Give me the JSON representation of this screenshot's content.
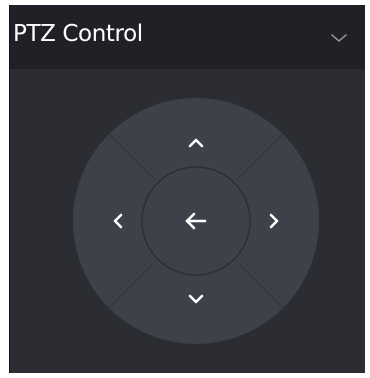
{
  "panel": {
    "title": "PTZ Control",
    "collapse_icon": "chevron-down-icon"
  },
  "ptz": {
    "buttons": [
      {
        "direction": "up",
        "icon": "chevron-up-icon"
      },
      {
        "direction": "left",
        "icon": "chevron-left-icon"
      },
      {
        "direction": "right",
        "icon": "chevron-right-icon"
      },
      {
        "direction": "down",
        "icon": "chevron-down-icon"
      },
      {
        "direction": "center",
        "icon": "arrow-left-icon"
      }
    ]
  },
  "colors": {
    "panel_background": "#2b2d33",
    "header_background": "#1f2126",
    "pad_fill": "#3e404a",
    "divider": "#33353d",
    "icon": "#ffffff",
    "collapse_icon": "#8e9097"
  }
}
